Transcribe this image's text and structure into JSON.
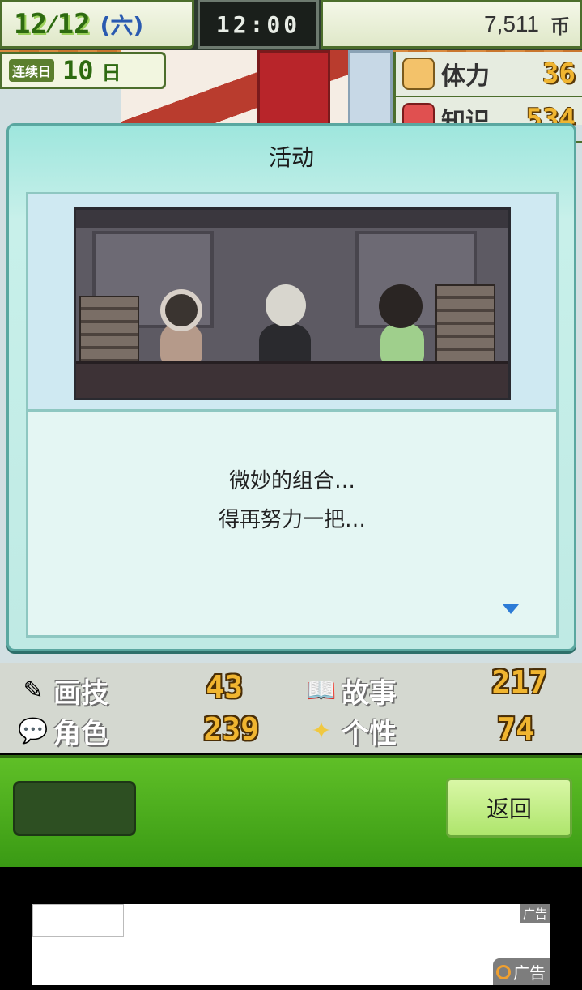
{
  "topbar": {
    "month": "12",
    "day": "12",
    "weekday": "(六)",
    "clock": "12:00",
    "money": "7,511",
    "money_unit": "币"
  },
  "streak": {
    "tag": "连续日",
    "count": "10",
    "unit": "日"
  },
  "side_stats": [
    {
      "label": "体力",
      "value": "36"
    },
    {
      "label": "知识",
      "value": "534"
    }
  ],
  "dialog": {
    "title": "活动",
    "message_line1": "微妙的组合…",
    "message_line2": "得再努力一把…"
  },
  "stats": {
    "drawing": {
      "label": "画技",
      "value": "43"
    },
    "story": {
      "label": "故事",
      "value": "217"
    },
    "character": {
      "label": "角色",
      "value": "239"
    },
    "personality": {
      "label": "个性",
      "value": "74"
    }
  },
  "actions": {
    "back_label": "返回"
  },
  "ad": {
    "tag_top": "广告",
    "tag_bottom": "广告"
  },
  "colors": {
    "accent_green": "#5fbf27",
    "dialog_teal": "#9ee6dd",
    "stat_gold": "#f0b530"
  }
}
